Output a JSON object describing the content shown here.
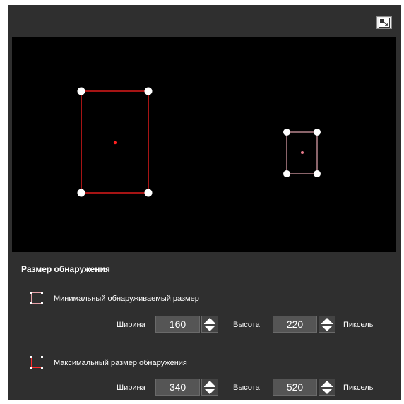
{
  "section_title": "Размер обнаружения",
  "colors": {
    "min_frame": "#ff2a2a",
    "max_frame": "#e8a0a8",
    "panel": "#2f2f2f",
    "viewport": "#000000"
  },
  "min_size": {
    "label": "Минимальный обнаруживаемый размер",
    "width_label": "Ширина",
    "width_value": "160",
    "height_label": "Высота",
    "height_value": "220",
    "unit": "Пиксель"
  },
  "max_size": {
    "label": "Максимальный размер обнаружения",
    "width_label": "Ширина",
    "width_value": "340",
    "height_label": "Высота",
    "height_value": "520",
    "unit": "Пиксель"
  },
  "icons": {
    "expand": "expand-icon",
    "spin_up": "arrow-up-icon",
    "spin_down": "arrow-down-icon"
  }
}
